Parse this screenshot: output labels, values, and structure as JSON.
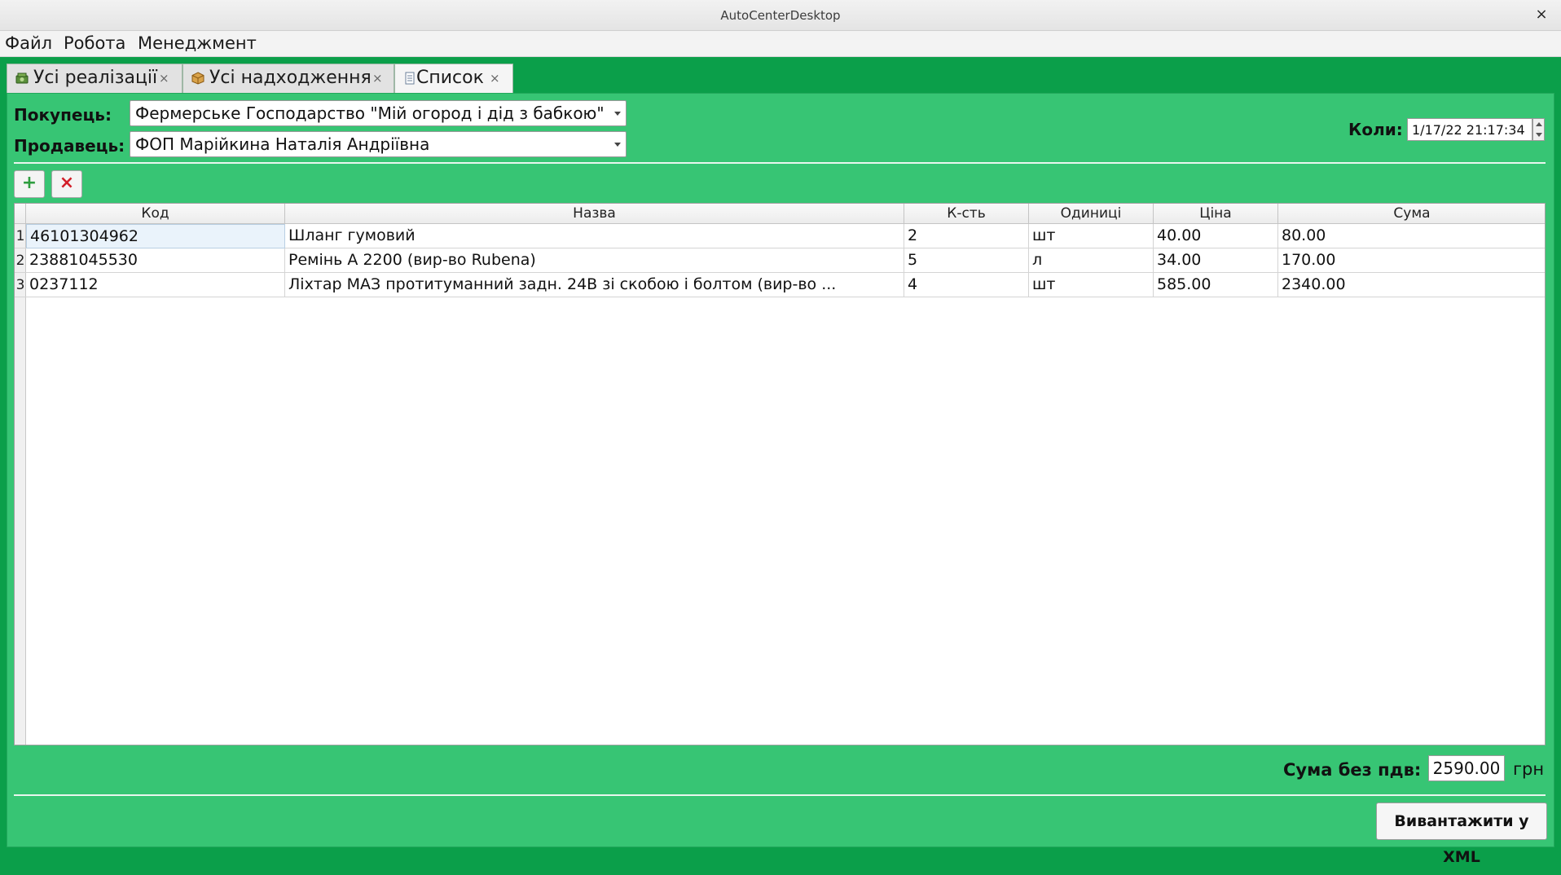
{
  "window": {
    "title": "AutoCenterDesktop",
    "close_glyph": "×"
  },
  "menu": {
    "items": [
      "Файл",
      "Робота",
      "Менеджмент"
    ]
  },
  "tabs": [
    {
      "label": "Усі реалізації",
      "icon": "cash-icon"
    },
    {
      "label": "Усі надходження",
      "icon": "box-icon"
    },
    {
      "label": "Список",
      "icon": "document-icon"
    }
  ],
  "tab_close_glyph": "×",
  "form": {
    "buyer_label": "Покупець:",
    "buyer_value": "Фермерське Господарство \"Мій огород і дід з бабкою\"",
    "seller_label": "Продавець:",
    "seller_value": "ФОП Марійкина Наталія Андріївна",
    "when_label": "Коли:",
    "when_value": "1/17/22 21:17:34"
  },
  "toolbar": {
    "add_glyph": "+",
    "delete_glyph": "×",
    "add_color": "#2e9d3f",
    "delete_color": "#d21f2a"
  },
  "table": {
    "columns": [
      "Код",
      "Назва",
      "К-сть",
      "Одиниці",
      "Ціна",
      "Сума"
    ],
    "rows": [
      {
        "num": "1",
        "code": "46101304962",
        "name": "Шланг гумовий",
        "qty": "2",
        "unit": "шт",
        "price": "40.00",
        "sum": "80.00"
      },
      {
        "num": "2",
        "code": "23881045530",
        "name": "Ремінь A 2200 (вир-во Rubena)",
        "qty": "5",
        "unit": "л",
        "price": "34.00",
        "sum": "170.00"
      },
      {
        "num": "3",
        "code": "0237112",
        "name": "Ліхтар МАЗ протитуманний задн. 24В зі скобою і болтом (вир-во ...",
        "qty": "4",
        "unit": "шт",
        "price": "585.00",
        "sum": "2340.00"
      }
    ]
  },
  "footer": {
    "total_label": "Сума без пдв:",
    "total_value": "2590.00",
    "currency": "грн",
    "export_button": "Вивантажити у XML"
  },
  "colors": {
    "background": "#0b9f4a",
    "panel": "#37c574",
    "selection": "#eaf3fb"
  }
}
